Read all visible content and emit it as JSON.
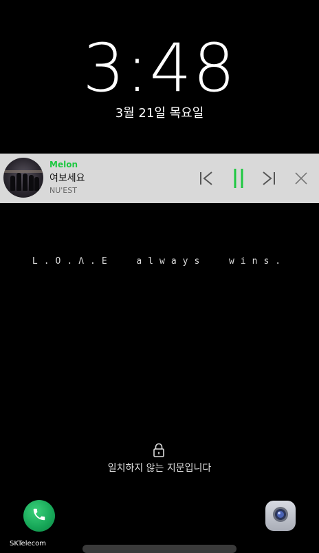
{
  "lockscreen": {
    "time": "3:48",
    "date": "3월 21일 목요일",
    "message": "L.O.Λ.E  always  wins.",
    "fingerprint_message": "일치하지 않는 지문입니다",
    "carrier": "SKTelecom"
  },
  "media_player": {
    "app_name": "Melon",
    "song_title": "여보세요",
    "artist": "NU'EST",
    "state": "playing"
  },
  "colors": {
    "melon_green": "#1ec841",
    "player_background": "#d9d9d9",
    "phone_button": "#16a557"
  },
  "icons": {
    "lock": "lock-icon",
    "phone": "phone-icon",
    "camera": "camera-icon",
    "previous": "skip-previous-icon",
    "pause": "pause-icon",
    "next": "skip-next-icon",
    "close": "close-icon"
  }
}
